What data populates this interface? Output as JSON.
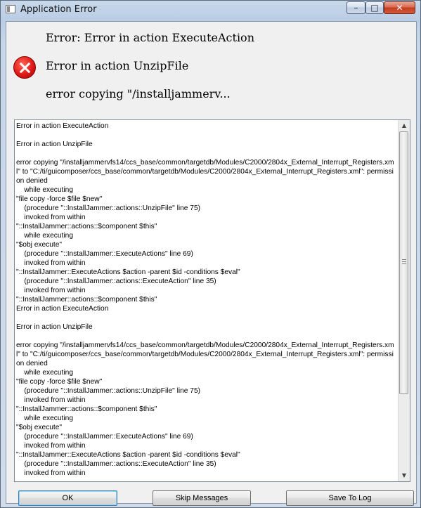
{
  "window": {
    "title": "Application Error",
    "minimize_glyph": "–",
    "maximize_glyph": "□",
    "close_glyph": "✕"
  },
  "messages": {
    "line1": "Error: Error in action ExecuteAction",
    "line2": "Error in action UnzipFile",
    "line3": "error copying \"/installjammerv..."
  },
  "icons": {
    "error": "error-icon"
  },
  "details": {
    "text": "Error in action ExecuteAction\n\nError in action UnzipFile\n\nerror copying \"/installjammervfs14/ccs_base/common/targetdb/Modules/C2000/2804x_External_Interrupt_Registers.xml\" to \"C:/ti/guicomposer/ccs_base/common/targetdb/Modules/C2000/2804x_External_Interrupt_Registers.xml\": permission denied\n    while executing\n\"file copy -force $file $new\"\n    (procedure \"::InstallJammer::actions::UnzipFile\" line 75)\n    invoked from within\n\"::InstallJammer::actions::$component $this\"\n    while executing\n\"$obj execute\"\n    (procedure \"::InstallJammer::ExecuteActions\" line 69)\n    invoked from within\n\"::InstallJammer::ExecuteActions $action -parent $id -conditions $eval\"\n    (procedure \"::InstallJammer::actions::ExecuteAction\" line 35)\n    invoked from within\n\"::InstallJammer::actions::$component $this\"\nError in action ExecuteAction\n\nError in action UnzipFile\n\nerror copying \"/installjammervfs14/ccs_base/common/targetdb/Modules/C2000/2804x_External_Interrupt_Registers.xml\" to \"C:/ti/guicomposer/ccs_base/common/targetdb/Modules/C2000/2804x_External_Interrupt_Registers.xml\": permission denied\n    while executing\n\"file copy -force $file $new\"\n    (procedure \"::InstallJammer::actions::UnzipFile\" line 75)\n    invoked from within\n\"::InstallJammer::actions::$component $this\"\n    while executing\n\"$obj execute\"\n    (procedure \"::InstallJammer::ExecuteActions\" line 69)\n    invoked from within\n\"::InstallJammer::ExecuteActions $action -parent $id -conditions $eval\"\n    (procedure \"::InstallJammer::actions::ExecuteAction\" line 35)\n    invoked from within"
  },
  "scrollbar": {
    "up_glyph": "▲",
    "down_glyph": "▼"
  },
  "buttons": {
    "ok": "OK",
    "skip": "Skip Messages",
    "save": "Save To Log"
  },
  "colors": {
    "error_red": "#e01818",
    "title_bar": "#b9cde4",
    "close_button": "#c43c1d",
    "default_button_border": "#3c7fb1"
  }
}
